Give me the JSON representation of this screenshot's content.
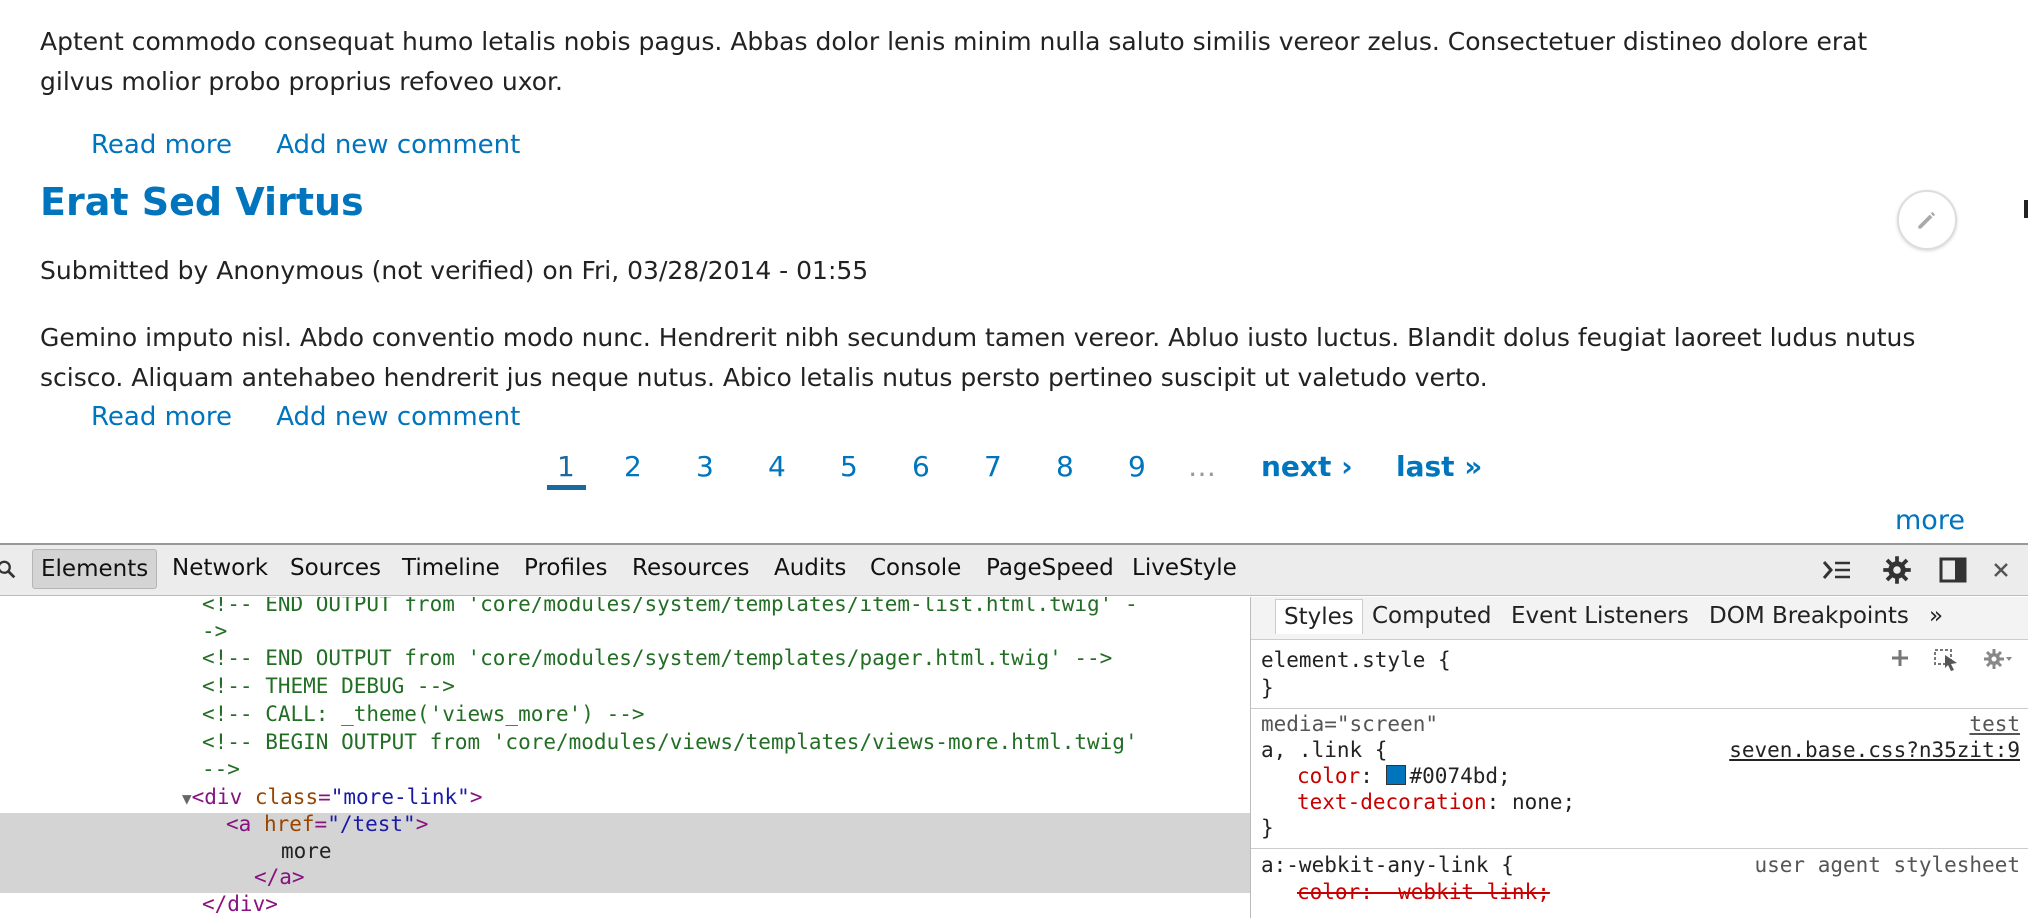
{
  "content": {
    "para1_line1": "Aptent commodo consequat humo letalis nobis pagus. Abbas dolor lenis minim nulla saluto similis vereor zelus. Consectetuer distineo dolore erat",
    "para1_line2": "gilvus molior probo proprius refoveo uxor.",
    "read_more": "Read more",
    "add_comment": "Add new comment",
    "article_title": "Erat Sed Virtus",
    "submitted": "Submitted by Anonymous (not verified) on Fri, 03/28/2014 - 01:55",
    "para2_line1": "Gemino imputo nisl. Abdo conventio modo nunc. Hendrerit nibh secundum tamen vereor. Abluo iusto luctus. Blandit dolus feugiat laoreet ludus nutus",
    "para2_line2": "scisco. Aliquam antehabeo hendrerit jus neque nutus. Abico letalis nutus persto pertineo suscipit ut valetudo verto."
  },
  "pager": {
    "pages": [
      "1",
      "2",
      "3",
      "4",
      "5",
      "6",
      "7",
      "8",
      "9"
    ],
    "current": "1",
    "ellipsis": "…",
    "next": "next ›",
    "last": "last »"
  },
  "more_link": "more",
  "devtools": {
    "tabs": [
      "Elements",
      "Network",
      "Sources",
      "Timeline",
      "Profiles",
      "Resources",
      "Audits",
      "Console",
      "PageSpeed",
      "LiveStyle"
    ],
    "active_tab": "Elements",
    "elements_lines": {
      "l1": "<!-- END OUTPUT from 'core/modules/system/templates/item-list.html.twig' -",
      "l2": "->",
      "l3": "<!-- END OUTPUT from 'core/modules/system/templates/pager.html.twig' -->",
      "l4": "<!-- THEME DEBUG -->",
      "l5": "<!-- CALL: _theme('views_more') -->",
      "l6": "<!-- BEGIN OUTPUT from 'core/modules/views/templates/views-more.html.twig'",
      "l7": "-->",
      "div_open_tag": "<div",
      "div_attr": "class",
      "div_attr_val": "\"more-link\"",
      "a_open_tag": "<a",
      "a_attr": "href",
      "a_attr_val": "\"/test\"",
      "a_text": "more",
      "a_close": "</a>",
      "div_close": "</div>"
    },
    "styles_tabs": [
      "Styles",
      "Computed",
      "Event Listeners",
      "DOM Breakpoints"
    ],
    "styles_active": "Styles",
    "styles_more": "»",
    "element_style": "element.style {",
    "close_brace": "}",
    "media": "media=\"screen\"",
    "rule_source_label": "test",
    "selector": "a, .link {",
    "rule_source": "seven.base.css?n35zit:9",
    "prop_color": "color",
    "prop_color_val": "#0074bd;",
    "prop_td": "text-decoration",
    "prop_td_val": "none;",
    "ua_selector": "a:-webkit-any-link {",
    "ua_label": "user agent stylesheet",
    "ua_prop": "color: -webkit-link;"
  }
}
